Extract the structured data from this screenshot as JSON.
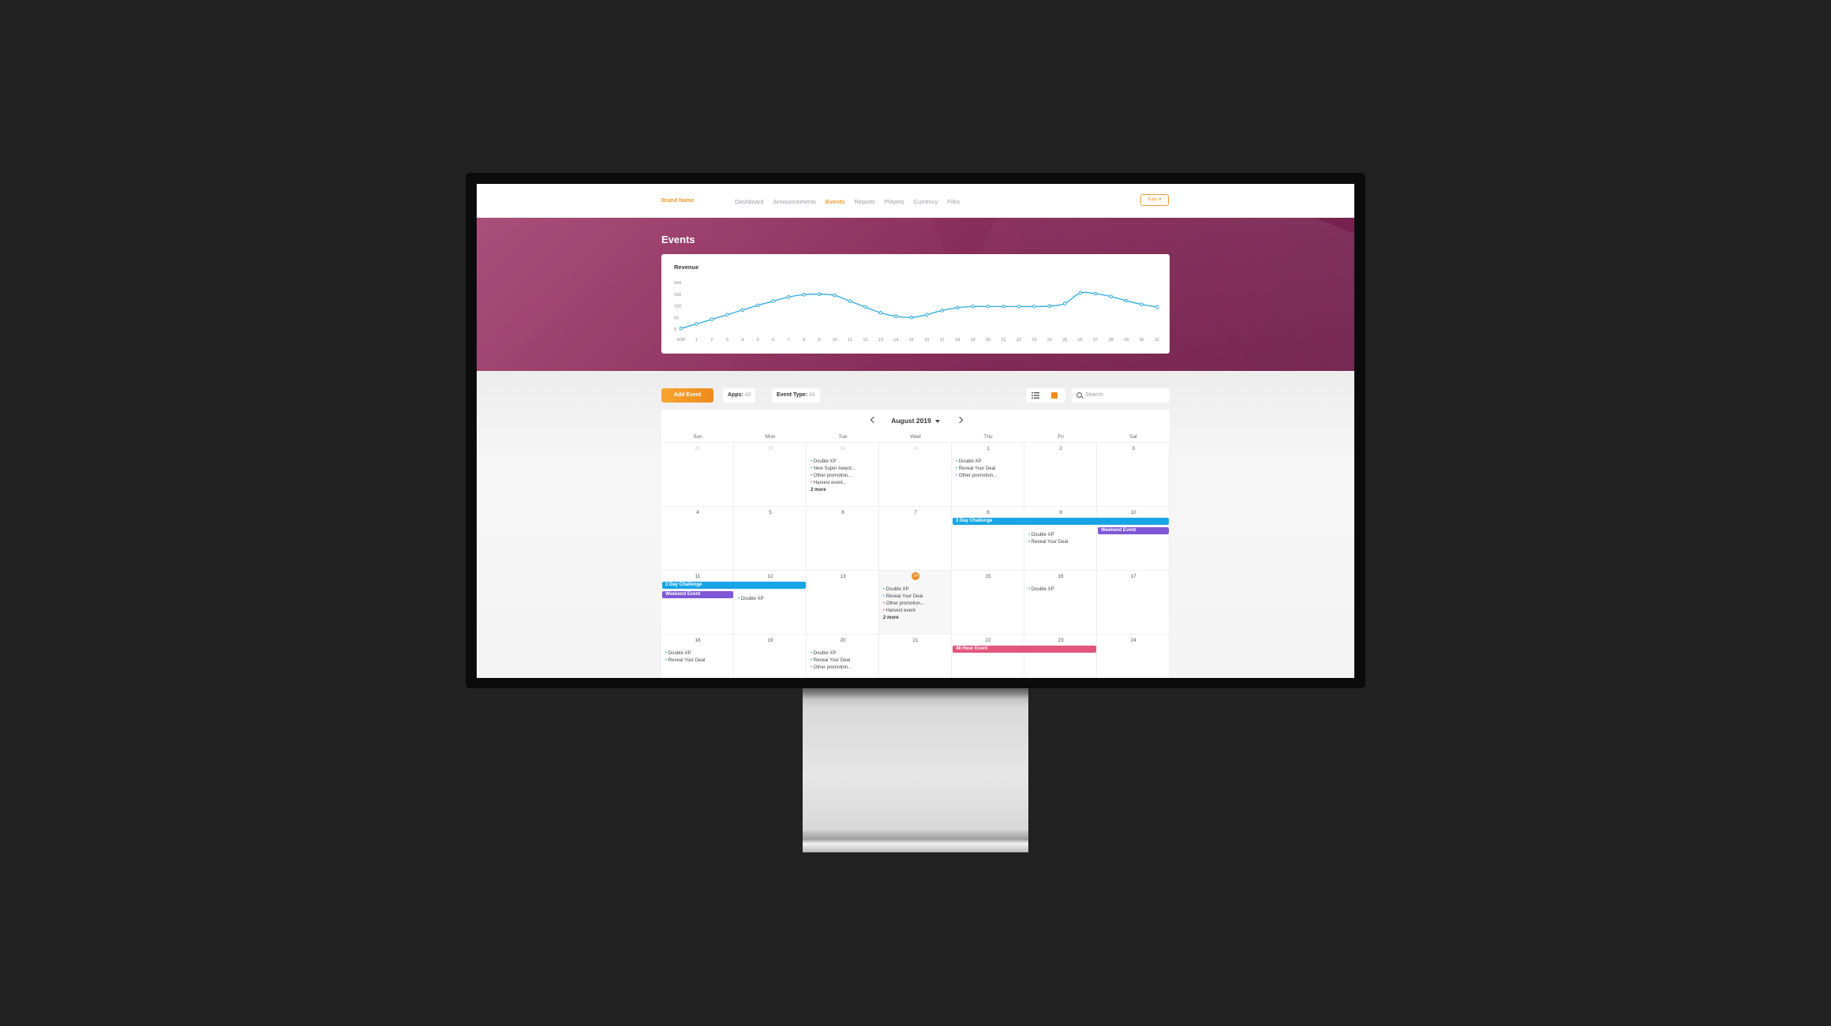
{
  "nav": {
    "brand": "Brand Name",
    "links": [
      "Dashboard",
      "Announcements",
      "Events",
      "Reports",
      "Players",
      "Currency",
      "Files"
    ],
    "active": "Events",
    "user": "Katy"
  },
  "page": {
    "title": "Events"
  },
  "chart_data": {
    "type": "line",
    "title": "Revenue",
    "x": [
      "4/30",
      "1",
      "2",
      "3",
      "4",
      "5",
      "6",
      "7",
      "8",
      "9",
      "10",
      "11",
      "12",
      "13",
      "14",
      "15",
      "16",
      "17",
      "18",
      "19",
      "20",
      "21",
      "22",
      "23",
      "24",
      "25",
      "26",
      "27",
      "28",
      "29",
      "30",
      "31"
    ],
    "values": [
      3,
      22,
      42,
      62,
      82,
      102,
      120,
      138,
      148,
      150,
      145,
      120,
      95,
      70,
      55,
      50,
      62,
      80,
      92,
      97,
      97,
      97,
      97,
      97,
      99,
      110,
      155,
      152,
      140,
      122,
      106,
      95
    ],
    "yticks": [
      "200",
      "150",
      "100",
      "50",
      "0"
    ],
    "ylim": [
      0,
      200
    ],
    "color": "#2aa8df",
    "grid": false
  },
  "toolbar": {
    "add_event": "Add Event",
    "apps_label": "Apps:",
    "apps_value": "All",
    "type_label": "Event Type:",
    "type_value": "All",
    "search_placeholder": "Search"
  },
  "calendar": {
    "month": "August 2019",
    "weekdays": [
      "Sun",
      "Mon",
      "Tue",
      "Wed",
      "Thu",
      "Fri",
      "Sat"
    ],
    "weeks": [
      [
        {
          "day": "28",
          "other": true
        },
        {
          "day": "29",
          "other": true
        },
        {
          "day": "30",
          "other": true,
          "events": [
            "Double XP",
            "New Super Award...",
            "Other promotion...",
            "Harvest event..."
          ],
          "more": "2 more"
        },
        {
          "day": "31",
          "other": true
        },
        {
          "day": "1",
          "events": [
            "Double XP",
            "Reveal Your Deal",
            "Other promotion..."
          ]
        },
        {
          "day": "2"
        },
        {
          "day": "3"
        }
      ],
      [
        {
          "day": "4"
        },
        {
          "day": "5"
        },
        {
          "day": "6"
        },
        {
          "day": "7"
        },
        {
          "day": "8"
        },
        {
          "day": "9",
          "events": [
            "Double XP",
            "Reveal Your Deal"
          ]
        },
        {
          "day": "10"
        }
      ],
      [
        {
          "day": "11"
        },
        {
          "day": "12",
          "events": [
            "Double XP"
          ]
        },
        {
          "day": "13"
        },
        {
          "day": "14",
          "today": true,
          "events": [
            "Double XP",
            "Reveal Your Deal",
            "Other promotion...",
            "Harvest event"
          ],
          "more": "2 more"
        },
        {
          "day": "15"
        },
        {
          "day": "16",
          "events": [
            "Double XP"
          ]
        },
        {
          "day": "17"
        }
      ],
      [
        {
          "day": "18",
          "events": [
            "Double XP",
            "Reveal Your Deal"
          ]
        },
        {
          "day": "19"
        },
        {
          "day": "20",
          "events": [
            "Double XP",
            "Reveal Your Deal",
            "Other promotion..."
          ]
        },
        {
          "day": "21"
        },
        {
          "day": "22"
        },
        {
          "day": "23"
        },
        {
          "day": "24"
        }
      ]
    ],
    "bars": [
      {
        "label": "3 Day Challenge",
        "week": 1,
        "start": 4,
        "span": 3,
        "row": 0,
        "color": "blue"
      },
      {
        "label": "Weekend Event",
        "week": 1,
        "start": 6,
        "span": 1,
        "row": 1,
        "color": "purple"
      },
      {
        "label": "3 Day Challenge",
        "week": 2,
        "start": 0,
        "span": 2,
        "row": 0,
        "color": "blue"
      },
      {
        "label": "Weekend Event",
        "week": 2,
        "start": 0,
        "span": 1,
        "row": 1,
        "color": "purple"
      },
      {
        "label": "48 Hour Event",
        "week": 3,
        "start": 4,
        "span": 2,
        "row": 0,
        "color": "pink"
      }
    ]
  }
}
